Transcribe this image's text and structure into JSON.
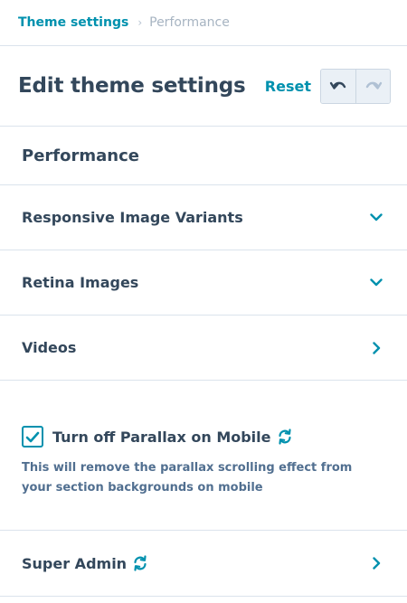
{
  "breadcrumb": {
    "parent": "Theme settings",
    "current": "Performance"
  },
  "header": {
    "title": "Edit theme settings",
    "reset_label": "Reset"
  },
  "section": {
    "title": "Performance"
  },
  "rows": [
    {
      "label": "Responsive Image Variants",
      "icon": "chevron-down-icon"
    },
    {
      "label": "Retina Images",
      "icon": "chevron-down-icon"
    },
    {
      "label": "Videos",
      "icon": "chevron-right-icon"
    }
  ],
  "parallax": {
    "checked": true,
    "label": "Turn off Parallax on Mobile",
    "help": "This will remove the parallax scrolling effect from your section backgrounds on mobile"
  },
  "super_admin": {
    "label": "Super Admin"
  },
  "colors": {
    "accent": "#0091ae",
    "text": "#33475b",
    "muted": "#516f90",
    "border": "#dbe3ec"
  }
}
